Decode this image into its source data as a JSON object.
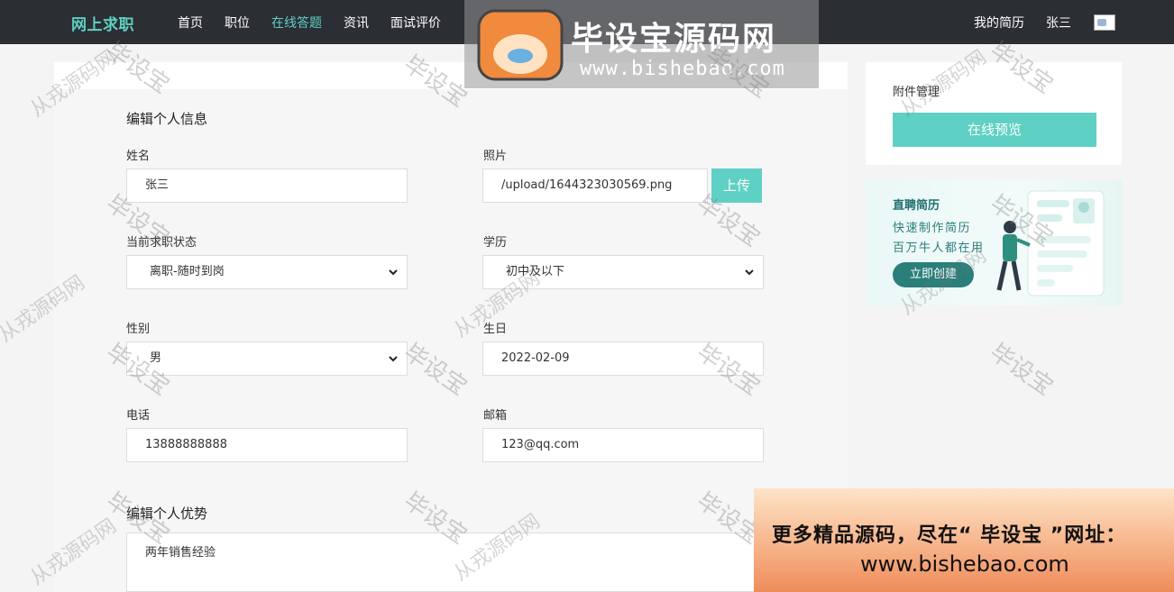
{
  "nav": {
    "brand": "网上求职",
    "items": [
      {
        "label": "首页",
        "active": false
      },
      {
        "label": "职位",
        "active": false
      },
      {
        "label": "在线答题",
        "active": true
      },
      {
        "label": "资讯",
        "active": false
      },
      {
        "label": "面试评价",
        "active": false
      }
    ],
    "my_resume": "我的简历",
    "username": "张三",
    "avatar_icon": "broken-image-icon"
  },
  "form": {
    "section_title": "编辑个人信息",
    "name": {
      "label": "姓名",
      "value": "张三"
    },
    "photo": {
      "label": "照片",
      "value": "/upload/1644323030569.png",
      "upload_label": "上传"
    },
    "job_status": {
      "label": "当前求职状态",
      "value": "离职-随时到岗"
    },
    "education": {
      "label": "学历",
      "value": "初中及以下"
    },
    "gender": {
      "label": "性别",
      "value": "男"
    },
    "birthday": {
      "label": "生日",
      "value": "2022-02-09"
    },
    "phone": {
      "label": "电话",
      "value": "13888888888"
    },
    "email": {
      "label": "邮箱",
      "value": "123@qq.com"
    },
    "advantage_title": "编辑个人优势",
    "advantage_value": "两年销售经验"
  },
  "sidebar": {
    "attachment_title": "附件管理",
    "preview_label": "在线预览",
    "banner": {
      "title": "直聘简历",
      "line1": "快速制作简历",
      "line2": "百万牛人都在用",
      "button": "立即创建"
    }
  },
  "watermark": {
    "logo_text": "毕设宝源码网",
    "logo_badge": "毕设宝",
    "logo_url": "www.bishebao.com",
    "tile_a": "毕设宝",
    "tile_b": "从戎源码网",
    "ad_line1": "更多精品源码，尽在“ 毕设宝 ”网址：",
    "ad_line2": "www.bishebao.com"
  },
  "colors": {
    "accent": "#5fd0c4",
    "topbar": "#2b2e33"
  }
}
